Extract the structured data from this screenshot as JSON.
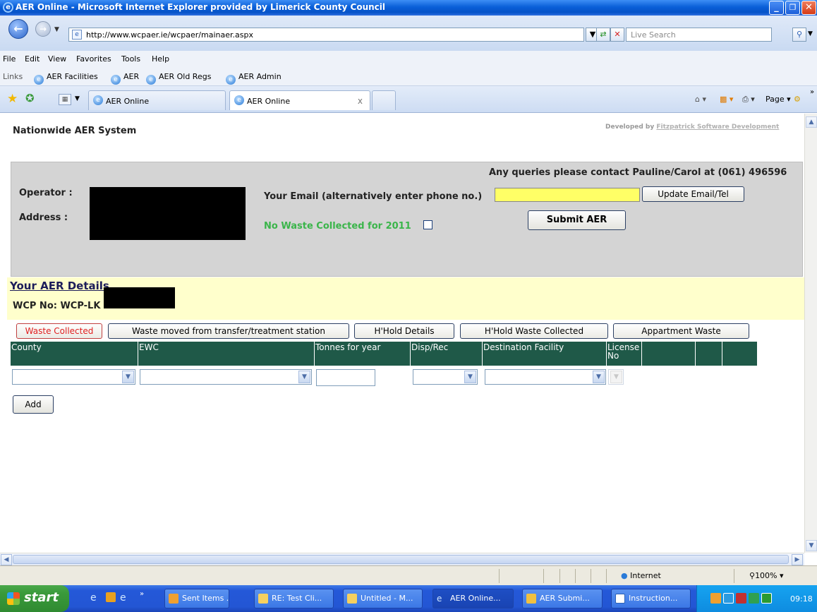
{
  "window": {
    "title": "AER Online - Microsoft Internet Explorer provided by Limerick County Council",
    "minimize": "_",
    "maximize": "❐",
    "close": "✕"
  },
  "browser": {
    "url": "http://www.wcpaer.ie/wcpaer/mainaer.aspx",
    "search_placeholder": "Live Search",
    "menu": [
      "File",
      "Edit",
      "View",
      "Favorites",
      "Tools",
      "Help"
    ],
    "links_label": "Links",
    "links": [
      "AER Facilities",
      "AER",
      "AER Old Regs",
      "AER Admin"
    ],
    "tabs": [
      {
        "label": "AER Online",
        "active": false
      },
      {
        "label": "AER Online",
        "active": true
      }
    ],
    "tab_close": "x",
    "toolbar": {
      "page": "Page",
      "tools": "Tools"
    }
  },
  "page": {
    "header_title": "Nationwide AER System",
    "developed_by_prefix": "Developed by",
    "developed_by_link": "Fitzpatrick Software Development",
    "queries": "Any queries please contact Pauline/Carol at (061) 496596",
    "operator_label": "Operator :",
    "address_label": "Address :",
    "email_label": "Your Email (alternatively enter phone no.)",
    "email_value": "",
    "update_button": "Update Email/Tel",
    "submit_button": "Submit AER",
    "no_waste_label": "No Waste Collected for 2011",
    "no_waste_checked": false,
    "details_title": "Your AER Details",
    "wcp_no": "WCP No: WCP-LK",
    "section_tabs": [
      {
        "label": "Waste Collected",
        "selected": true
      },
      {
        "label": "Waste moved from transfer/treatment station",
        "selected": false
      },
      {
        "label": "H'Hold Details",
        "selected": false
      },
      {
        "label": "H'Hold Waste Collected",
        "selected": false
      },
      {
        "label": "Appartment Waste",
        "selected": false
      }
    ],
    "grid_columns": [
      "County",
      "EWC",
      "Tonnes for year",
      "Disp/Rec",
      "Destination Facility",
      "License No",
      "",
      "",
      ""
    ],
    "add_button": "Add",
    "header_color": "#1f5948",
    "selected_tab_color": "#e02020",
    "no_waste_color": "#3ab54a"
  },
  "statusbar": {
    "zone": "Internet",
    "zoom": "100%"
  },
  "taskbar": {
    "start": "start",
    "tasks": [
      {
        "label": "Sent Items ...",
        "active": false
      },
      {
        "label": "RE: Test Cli...",
        "active": false
      },
      {
        "label": "Untitled - M...",
        "active": false
      },
      {
        "label": "AER Online...",
        "active": true
      },
      {
        "label": "AER Submi...",
        "active": false
      },
      {
        "label": "Instruction...",
        "active": false
      }
    ],
    "clock": "09:18"
  }
}
